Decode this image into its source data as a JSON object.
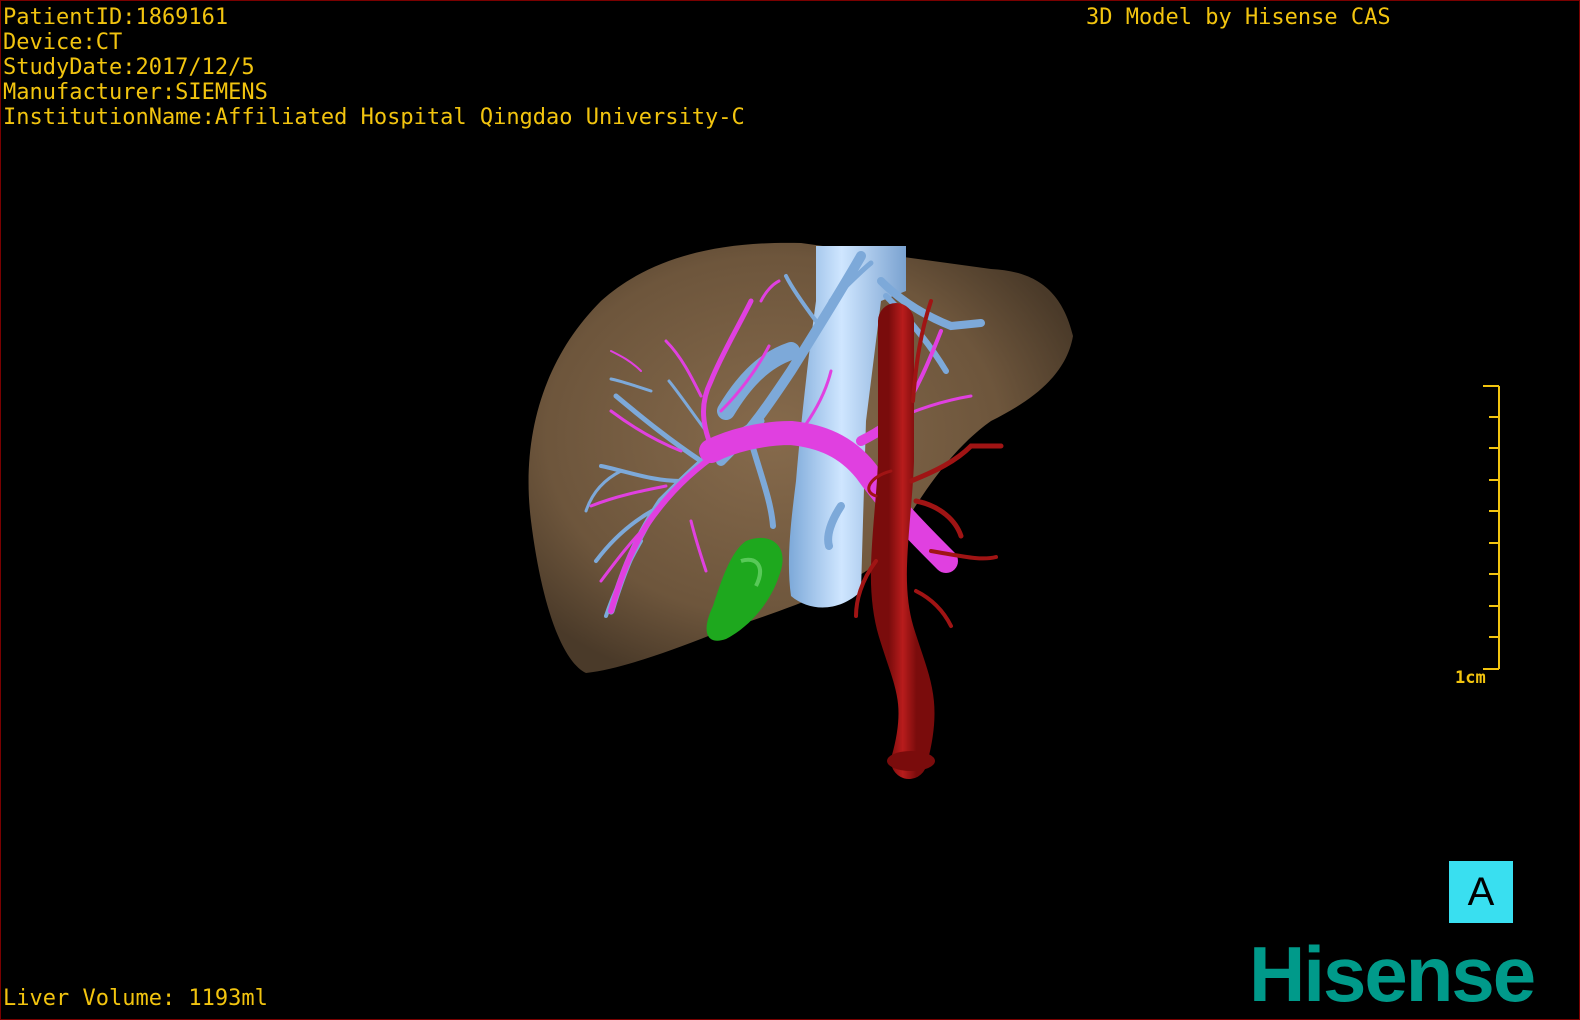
{
  "overlay": {
    "patient_id": "PatientID:1869161",
    "device": "Device:CT",
    "study_date": "StudyDate:2017/12/5",
    "manufacturer": "Manufacturer:SIEMENS",
    "institution": "InstitutionName:Affiliated Hospital Qingdao University-C",
    "brand_text": "3D Model by Hisense CAS",
    "liver_volume": "Liver Volume: 1193ml",
    "scale_label": "1cm",
    "orientation_label": "A",
    "logo_text": "Hisense"
  },
  "colors": {
    "overlay_text": "#f2c40f",
    "liver": "#7c6245",
    "hepatic_vein": "#7da9d9",
    "ivc": "#a9cdf0",
    "portal_vein": "#e040e0",
    "artery": "#a01414",
    "gallbladder": "#1ea81e",
    "orientation_button": "#39dff0",
    "logo": "#009a8a",
    "border": "#7a0000"
  }
}
